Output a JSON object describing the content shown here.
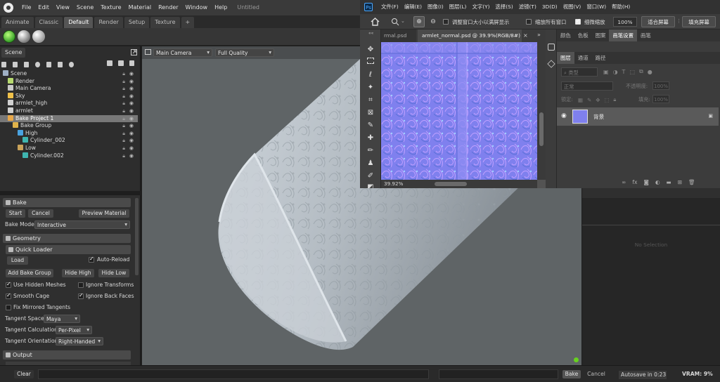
{
  "toolbag": {
    "menus": [
      "File",
      "Edit",
      "View",
      "Scene",
      "Texture",
      "Material",
      "Render",
      "Window",
      "Help"
    ],
    "doc_title": "Untitled",
    "tabs": [
      "Animate",
      "Classic",
      "Default",
      "Render",
      "Setup",
      "Texture",
      "+"
    ],
    "active_tab": "Default",
    "scene_panel": {
      "tab_label": "Scene",
      "tree": [
        {
          "label": "Scene",
          "indent": 0,
          "icon": "scene-icon",
          "color": "#9fb0c4"
        },
        {
          "label": "Render",
          "indent": 1,
          "icon": "render-icon",
          "color": "#b6d96f"
        },
        {
          "label": "Main Camera",
          "indent": 1,
          "icon": "camera-icon",
          "color": "#c9c9c9"
        },
        {
          "label": "Sky",
          "indent": 1,
          "icon": "sky-icon",
          "color": "#f0c14a"
        },
        {
          "label": "armlet_high",
          "indent": 1,
          "icon": "mesh-icon",
          "color": "#d0d0d0"
        },
        {
          "label": "armlet",
          "indent": 1,
          "icon": "mesh-icon",
          "color": "#d0d0d0"
        },
        {
          "label": "Bake Project 1",
          "indent": 1,
          "icon": "bake-project-icon",
          "color": "#e8a84a",
          "selected": true
        },
        {
          "label": "Bake Group",
          "indent": 2,
          "icon": "folder-icon",
          "color": "#e0b24a"
        },
        {
          "label": "High",
          "indent": 3,
          "icon": "high-group-icon",
          "color": "#4aa3e0"
        },
        {
          "label": "Cylinder_002",
          "indent": 4,
          "icon": "cube-icon",
          "color": "#3fb5b0"
        },
        {
          "label": "Low",
          "indent": 3,
          "icon": "low-group-icon",
          "color": "#c9a35a"
        },
        {
          "label": "Cylinder.002",
          "indent": 4,
          "icon": "cube-icon",
          "color": "#3fb5b0"
        }
      ]
    },
    "bake": {
      "section_label": "Bake",
      "start": "Start",
      "cancel": "Cancel",
      "preview": "Preview Material",
      "mode_label": "Bake Mode",
      "mode_value": "Interactive"
    },
    "geometry": {
      "section_label": "Geometry",
      "quick_loader": "Quick Loader",
      "load": "Load",
      "auto_reload": "Auto-Reload",
      "add_group": "Add Bake Group",
      "hide_high": "Hide High",
      "hide_low": "Hide Low",
      "use_hidden": "Use Hidden Meshes",
      "ignore_transforms": "Ignore Transforms",
      "smooth_cage": "Smooth Cage",
      "ignore_back": "Ignore Back Faces",
      "fix_mirrored": "Fix Mirrored Tangents",
      "tangent_space_label": "Tangent Space",
      "tangent_space_value": "Maya",
      "tangent_calc_label": "Tangent Calculation",
      "tangent_calc_value": "Per-Pixel",
      "tangent_orient_label": "Tangent Orientation",
      "tangent_orient_value": "Right-Handed"
    },
    "output": {
      "section_label": "Output"
    },
    "viewport": {
      "camera": "Main Camera",
      "quality": "Full Quality"
    },
    "right_panel": {
      "placeholder": "No Selection"
    },
    "status": {
      "clear": "Clear",
      "bake": "Bake",
      "cancel": "Cancel",
      "autosave": "Autosave in 0:23",
      "vram": "VRAM: 9%"
    }
  },
  "photoshop": {
    "logo": "Ps",
    "menus": [
      "文件(F)",
      "编辑(E)",
      "图像(I)",
      "图层(L)",
      "文字(Y)",
      "选择(S)",
      "滤镜(T)",
      "3D(D)",
      "视图(V)",
      "窗口(W)",
      "帮助(H)"
    ],
    "options": {
      "resize_windows": "调整窗口大小以满屏显示",
      "zoom_all": "缩放所有窗口",
      "scrubby_zoom": "细微缩放",
      "zoom_value": "100%",
      "fit_screen": "适合屏幕",
      "fill_screen": "填充屏幕"
    },
    "doc_tabs": [
      "rmal.psd",
      "armlet_normal.psd @ 39.9%(RGB/8#)"
    ],
    "zoom_status": "39.92%",
    "panel_tabs_top": [
      "颜色",
      "色板",
      "图案",
      "画笔设置",
      "画笔"
    ],
    "panel_tabs_layers": [
      "图层",
      "通道",
      "路径"
    ],
    "layer_filter_label": "类型",
    "blend_mode": "正常",
    "opacity_label": "不透明度:",
    "opacity_value": "100%",
    "lock_label": "锁定:",
    "fill_label": "填充:",
    "fill_value": "100%",
    "layer_name": "背景",
    "colors": {
      "normal_map": "#7f80ee"
    }
  }
}
